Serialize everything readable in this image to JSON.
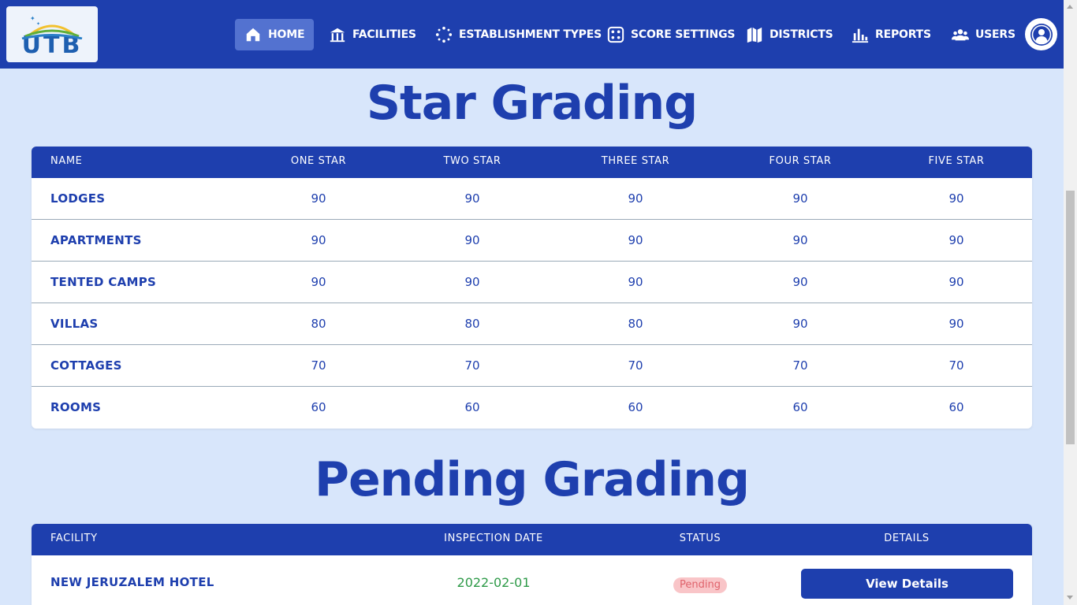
{
  "header": {
    "logo_text": "UTB",
    "nav": [
      {
        "label": "HOME",
        "icon": "home-icon",
        "active": true
      },
      {
        "label": "FACILITIES",
        "icon": "facilities-icon"
      },
      {
        "label": "ESTABLISHMENT TYPES",
        "icon": "establishment-types-icon"
      },
      {
        "label": "SCORE SETTINGS",
        "icon": "score-settings-icon"
      },
      {
        "label": "DISTRICTS",
        "icon": "districts-map-icon"
      },
      {
        "label": "REPORTS",
        "icon": "bar-chart-icon"
      },
      {
        "label": "USERS",
        "icon": "users-icon"
      }
    ],
    "avatar_icon": "user-avatar-icon"
  },
  "star_grading": {
    "title": "Star Grading",
    "columns": [
      "NAME",
      "ONE STAR",
      "TWO STAR",
      "THREE STAR",
      "FOUR STAR",
      "FIVE STAR"
    ],
    "rows": [
      {
        "name": "LODGES",
        "values": [
          "90",
          "90",
          "90",
          "90",
          "90"
        ]
      },
      {
        "name": "APARTMENTS",
        "values": [
          "90",
          "90",
          "90",
          "90",
          "90"
        ]
      },
      {
        "name": "TENTED CAMPS",
        "values": [
          "90",
          "90",
          "90",
          "90",
          "90"
        ]
      },
      {
        "name": "VILLAS",
        "values": [
          "80",
          "80",
          "80",
          "90",
          "90"
        ]
      },
      {
        "name": "COTTAGES",
        "values": [
          "70",
          "70",
          "70",
          "70",
          "70"
        ]
      },
      {
        "name": "ROOMS",
        "values": [
          "60",
          "60",
          "60",
          "60",
          "60"
        ]
      }
    ]
  },
  "pending_grading": {
    "title": "Pending Grading",
    "columns": [
      "FACILITY",
      "INSPECTION DATE",
      "STATUS",
      "DETAILS"
    ],
    "rows": [
      {
        "facility": "NEW JERUZALEM HOTEL",
        "inspection_date": "2022-02-01",
        "status": "Pending",
        "details_label": "View Details"
      }
    ]
  },
  "colors": {
    "primary": "#1e3fae",
    "background": "#d8e6fb",
    "active_nav": "#5372d0",
    "date_green": "#2e9a48",
    "pending_badge_bg": "#f9c5c8",
    "pending_badge_text": "#e0636c"
  }
}
